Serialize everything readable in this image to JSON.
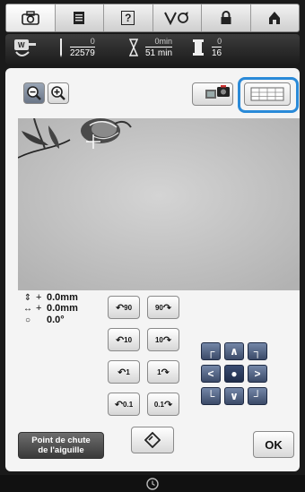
{
  "toolbar": {
    "items": [
      {
        "icon": "camera-icon"
      },
      {
        "icon": "page-icon"
      },
      {
        "icon": "help-icon",
        "label": "?"
      },
      {
        "icon": "thread-change-icon"
      },
      {
        "icon": "lock-icon"
      },
      {
        "icon": "home-icon"
      }
    ]
  },
  "status": {
    "stitch_done": "0",
    "stitch_total": "22579",
    "time_done": "0",
    "time_done_unit": "min",
    "time_total": "51",
    "time_total_unit": "min",
    "color_done": "0",
    "color_total": "16"
  },
  "offsets": {
    "vertical": "0.0mm",
    "horizontal": "0.0mm",
    "rotation": "0.0°"
  },
  "rotate_buttons": {
    "left_90": "90",
    "right_90": "90",
    "left_10": "10",
    "right_10": "10",
    "left_1": "1",
    "right_1": "1",
    "left_01": "0.1",
    "right_01": "0.1"
  },
  "needle_drop": {
    "line1": "Point de chute",
    "line2": "de l'aiguille"
  },
  "ok_label": "OK",
  "colors": {
    "highlight": "#2a8ad8",
    "pad": "#3b4a68"
  }
}
